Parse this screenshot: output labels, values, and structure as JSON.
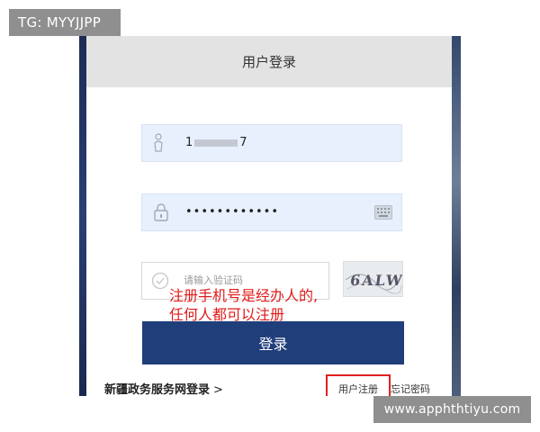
{
  "overlay": {
    "tg_label": "TG: MYYJJPP",
    "watermark_url": "www.apphthtiyu.com"
  },
  "login": {
    "title": "用户登录",
    "username_value_start": "1",
    "username_value_end": "7",
    "password_dots": "••••••••••••",
    "captcha_placeholder": "请输入验证码",
    "captcha_text": "6ALW",
    "submit_label": "登录",
    "gov_link_label": "新疆政务服务网登录",
    "gov_link_arrow": ">",
    "register_label": "用户注册",
    "forgot_label": "忘记密码"
  },
  "annotation": {
    "line1": "注册手机号是经办人的,",
    "line2": "任何人都可以注册"
  },
  "colors": {
    "primary": "#203e7a",
    "highlight": "#e02020",
    "field_bg": "#e8f0fe"
  },
  "icons": [
    "user-icon",
    "lock-icon",
    "keyboard-icon",
    "check-circle-icon"
  ]
}
